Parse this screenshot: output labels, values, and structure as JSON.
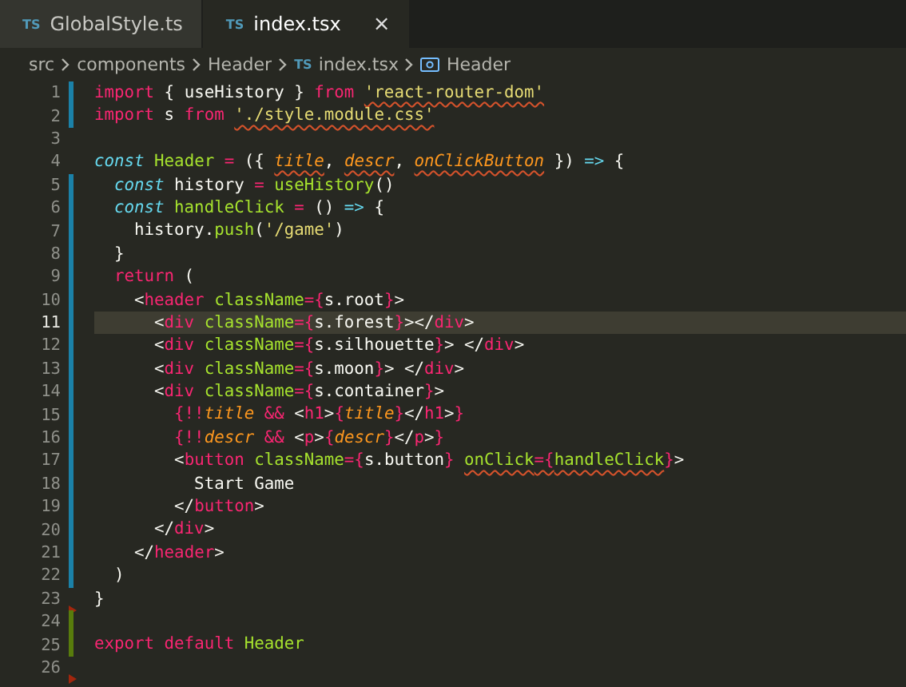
{
  "tabs": [
    {
      "icon": "TS",
      "label": "GlobalStyle.ts",
      "selected": false
    },
    {
      "icon": "TS",
      "label": "index.tsx",
      "selected": true,
      "close": "×"
    }
  ],
  "breadcrumbs": [
    {
      "kind": "folder",
      "label": "src"
    },
    {
      "kind": "folder",
      "label": "components"
    },
    {
      "kind": "folder",
      "label": "Header"
    },
    {
      "kind": "file",
      "icon": "TS",
      "label": "index.tsx"
    },
    {
      "kind": "symbol",
      "label": "Header"
    }
  ],
  "lines": [
    {
      "number": "1",
      "modified": true,
      "added": false,
      "deleted": false,
      "current": false,
      "tokens": [
        {
          "kind": "keyword",
          "text": "import"
        },
        {
          "kind": "plain",
          "text": " { useHistory } "
        },
        {
          "kind": "keyword",
          "text": "from "
        },
        {
          "kind": "string",
          "text": "'react-router-dom'",
          "squiggle": true
        }
      ]
    },
    {
      "number": "2",
      "modified": true,
      "added": false,
      "deleted": false,
      "current": false,
      "tokens": [
        {
          "kind": "keyword",
          "text": "import"
        },
        {
          "kind": "plain",
          "text": " s "
        },
        {
          "kind": "keyword",
          "text": "from "
        },
        {
          "kind": "string",
          "text": "'./style.module.css'",
          "squiggle": true
        }
      ]
    },
    {
      "number": "3",
      "modified": false,
      "added": false,
      "deleted": false,
      "current": false
    },
    {
      "number": "4",
      "modified": false,
      "added": false,
      "deleted": false,
      "current": false,
      "tokens": [
        {
          "kind": "storage",
          "text": "const "
        },
        {
          "kind": "name",
          "text": "Header "
        },
        {
          "kind": "keyword",
          "text": "= "
        },
        {
          "kind": "plain",
          "text": "({ "
        },
        {
          "kind": "param",
          "text": "title",
          "squiggle": true
        },
        {
          "kind": "plain",
          "text": ", "
        },
        {
          "kind": "param",
          "text": "descr",
          "squiggle": true
        },
        {
          "kind": "plain",
          "text": ", "
        },
        {
          "kind": "param",
          "text": "onClickButton",
          "squiggle": true
        },
        {
          "kind": "plain",
          "text": " }) "
        },
        {
          "kind": "storage",
          "text": "=>"
        },
        {
          "kind": "plain",
          "text": " {"
        }
      ]
    },
    {
      "number": "5",
      "modified": true,
      "added": false,
      "deleted": false,
      "current": false,
      "tokens": [
        {
          "kind": "storage",
          "text": "  const"
        },
        {
          "kind": "plain",
          "text": " history "
        },
        {
          "kind": "keyword",
          "text": "= "
        },
        {
          "kind": "name",
          "text": "useHistory"
        },
        {
          "kind": "plain",
          "text": "()"
        }
      ]
    },
    {
      "number": "6",
      "modified": true,
      "added": false,
      "deleted": false,
      "current": false,
      "tokens": [
        {
          "kind": "storage",
          "text": "  const "
        },
        {
          "kind": "name",
          "text": "handleClick "
        },
        {
          "kind": "keyword",
          "text": "= "
        },
        {
          "kind": "plain",
          "text": "() "
        },
        {
          "kind": "storage",
          "text": "=>"
        },
        {
          "kind": "plain",
          "text": " {"
        }
      ]
    },
    {
      "number": "7",
      "modified": true,
      "added": false,
      "deleted": false,
      "current": false,
      "tokens": [
        {
          "kind": "plain",
          "text": "    history."
        },
        {
          "kind": "name",
          "text": "push"
        },
        {
          "kind": "plain",
          "text": "("
        },
        {
          "kind": "string",
          "text": "'/game'"
        },
        {
          "kind": "plain",
          "text": ")"
        }
      ]
    },
    {
      "number": "8",
      "modified": true,
      "added": false,
      "deleted": false,
      "current": false,
      "tokens": [
        {
          "kind": "plain",
          "text": "  }"
        }
      ]
    },
    {
      "number": "9",
      "modified": true,
      "added": false,
      "deleted": false,
      "current": false,
      "tokens": [
        {
          "kind": "keyword",
          "text": "  return"
        },
        {
          "kind": "plain",
          "text": " ("
        }
      ]
    },
    {
      "number": "10",
      "modified": true,
      "added": false,
      "deleted": false,
      "current": false,
      "tokens": [
        {
          "kind": "plain",
          "text": "    <"
        },
        {
          "kind": "keyword",
          "text": "header "
        },
        {
          "kind": "name",
          "text": "className"
        },
        {
          "kind": "keyword",
          "text": "={"
        },
        {
          "kind": "plain",
          "text": "s.root"
        },
        {
          "kind": "keyword",
          "text": "}"
        },
        {
          "kind": "plain",
          "text": ">"
        }
      ]
    },
    {
      "number": "11",
      "modified": true,
      "added": false,
      "deleted": false,
      "current": true,
      "tokens": [
        {
          "kind": "plain",
          "text": "      <"
        },
        {
          "kind": "keyword",
          "text": "div "
        },
        {
          "kind": "name",
          "text": "className"
        },
        {
          "kind": "keyword",
          "text": "={"
        },
        {
          "kind": "plain",
          "text": "s.forest"
        },
        {
          "kind": "keyword",
          "text": "}"
        },
        {
          "kind": "plain",
          "text": "></"
        },
        {
          "kind": "keyword",
          "text": "div"
        },
        {
          "kind": "plain",
          "text": ">"
        }
      ]
    },
    {
      "number": "12",
      "modified": true,
      "added": false,
      "deleted": false,
      "current": false,
      "tokens": [
        {
          "kind": "plain",
          "text": "      <"
        },
        {
          "kind": "keyword",
          "text": "div "
        },
        {
          "kind": "name",
          "text": "className"
        },
        {
          "kind": "keyword",
          "text": "={"
        },
        {
          "kind": "plain",
          "text": "s.silhouette"
        },
        {
          "kind": "keyword",
          "text": "}"
        },
        {
          "kind": "plain",
          "text": "> </"
        },
        {
          "kind": "keyword",
          "text": "div"
        },
        {
          "kind": "plain",
          "text": ">"
        }
      ]
    },
    {
      "number": "13",
      "modified": true,
      "added": false,
      "deleted": false,
      "current": false,
      "tokens": [
        {
          "kind": "plain",
          "text": "      <"
        },
        {
          "kind": "keyword",
          "text": "div "
        },
        {
          "kind": "name",
          "text": "className"
        },
        {
          "kind": "keyword",
          "text": "={"
        },
        {
          "kind": "plain",
          "text": "s.moon"
        },
        {
          "kind": "keyword",
          "text": "}"
        },
        {
          "kind": "plain",
          "text": "> </"
        },
        {
          "kind": "keyword",
          "text": "div"
        },
        {
          "kind": "plain",
          "text": ">"
        }
      ]
    },
    {
      "number": "14",
      "modified": true,
      "added": false,
      "deleted": false,
      "current": false,
      "tokens": [
        {
          "kind": "plain",
          "text": "      <"
        },
        {
          "kind": "keyword",
          "text": "div "
        },
        {
          "kind": "name",
          "text": "className"
        },
        {
          "kind": "keyword",
          "text": "={"
        },
        {
          "kind": "plain",
          "text": "s.container"
        },
        {
          "kind": "keyword",
          "text": "}"
        },
        {
          "kind": "plain",
          "text": ">"
        }
      ]
    },
    {
      "number": "15",
      "modified": true,
      "added": false,
      "deleted": false,
      "current": false,
      "tokens": [
        {
          "kind": "keyword",
          "text": "        {!!"
        },
        {
          "kind": "param",
          "text": "title"
        },
        {
          "kind": "keyword",
          "text": " && "
        },
        {
          "kind": "plain",
          "text": "<"
        },
        {
          "kind": "keyword",
          "text": "h1"
        },
        {
          "kind": "plain",
          "text": ">"
        },
        {
          "kind": "keyword",
          "text": "{"
        },
        {
          "kind": "param",
          "text": "title"
        },
        {
          "kind": "keyword",
          "text": "}"
        },
        {
          "kind": "plain",
          "text": "</"
        },
        {
          "kind": "keyword",
          "text": "h1"
        },
        {
          "kind": "plain",
          "text": ">"
        },
        {
          "kind": "keyword",
          "text": "}"
        }
      ]
    },
    {
      "number": "16",
      "modified": true,
      "added": false,
      "deleted": false,
      "current": false,
      "tokens": [
        {
          "kind": "keyword",
          "text": "        {!!"
        },
        {
          "kind": "param",
          "text": "descr"
        },
        {
          "kind": "keyword",
          "text": " && "
        },
        {
          "kind": "plain",
          "text": "<"
        },
        {
          "kind": "keyword",
          "text": "p"
        },
        {
          "kind": "plain",
          "text": ">"
        },
        {
          "kind": "keyword",
          "text": "{"
        },
        {
          "kind": "param",
          "text": "descr"
        },
        {
          "kind": "keyword",
          "text": "}"
        },
        {
          "kind": "plain",
          "text": "</"
        },
        {
          "kind": "keyword",
          "text": "p"
        },
        {
          "kind": "plain",
          "text": ">"
        },
        {
          "kind": "keyword",
          "text": "}"
        }
      ]
    },
    {
      "number": "17",
      "modified": true,
      "added": false,
      "deleted": false,
      "current": false,
      "tokens": [
        {
          "kind": "plain",
          "text": "        <"
        },
        {
          "kind": "keyword",
          "text": "button "
        },
        {
          "kind": "name",
          "text": "className"
        },
        {
          "kind": "keyword",
          "text": "={"
        },
        {
          "kind": "plain",
          "text": "s.button"
        },
        {
          "kind": "keyword",
          "text": "} "
        },
        {
          "kind": "name",
          "text": "onClick",
          "squiggle": true
        },
        {
          "kind": "keyword",
          "text": "={",
          "squiggle": true
        },
        {
          "kind": "name",
          "text": "handleClick",
          "squiggle": true
        },
        {
          "kind": "keyword",
          "text": "}"
        },
        {
          "kind": "plain",
          "text": ">"
        }
      ]
    },
    {
      "number": "18",
      "modified": true,
      "added": false,
      "deleted": false,
      "current": false,
      "tokens": [
        {
          "kind": "plain",
          "text": "          Start Game"
        }
      ]
    },
    {
      "number": "19",
      "modified": true,
      "added": false,
      "deleted": false,
      "current": false,
      "tokens": [
        {
          "kind": "plain",
          "text": "        </"
        },
        {
          "kind": "keyword",
          "text": "button"
        },
        {
          "kind": "plain",
          "text": ">"
        }
      ]
    },
    {
      "number": "20",
      "modified": true,
      "added": false,
      "deleted": false,
      "current": false,
      "tokens": [
        {
          "kind": "plain",
          "text": "      </"
        },
        {
          "kind": "keyword",
          "text": "div"
        },
        {
          "kind": "plain",
          "text": ">"
        }
      ]
    },
    {
      "number": "21",
      "modified": true,
      "added": false,
      "deleted": false,
      "current": false,
      "tokens": [
        {
          "kind": "plain",
          "text": "    </"
        },
        {
          "kind": "keyword",
          "text": "header"
        },
        {
          "kind": "plain",
          "text": ">"
        }
      ]
    },
    {
      "number": "22",
      "modified": true,
      "added": false,
      "deleted": false,
      "current": false,
      "tokens": [
        {
          "kind": "plain",
          "text": "  )"
        }
      ]
    },
    {
      "number": "23",
      "modified": false,
      "added": false,
      "deleted": true,
      "current": false,
      "tokens": [
        {
          "kind": "plain",
          "text": "}"
        }
      ]
    },
    {
      "number": "24",
      "modified": false,
      "added": true,
      "deleted": false,
      "current": false
    },
    {
      "number": "25",
      "modified": false,
      "added": true,
      "deleted": false,
      "current": false,
      "tokens": [
        {
          "kind": "keyword",
          "text": "export "
        },
        {
          "kind": "keyword",
          "text": "default "
        },
        {
          "kind": "name",
          "text": "Header"
        }
      ]
    },
    {
      "number": "26",
      "modified": false,
      "added": false,
      "deleted": true,
      "current": false
    }
  ]
}
